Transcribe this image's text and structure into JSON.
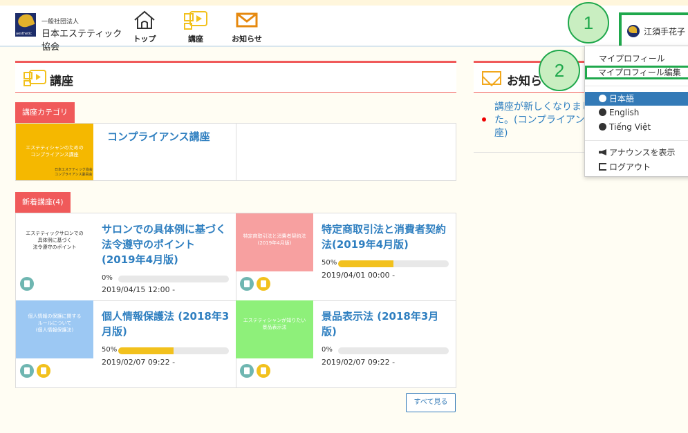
{
  "header": {
    "logo_small": "一般社団法人",
    "logo_big": "日本エステティック協会",
    "logo_mark_text": "aesthetic",
    "nav": [
      {
        "label": "トップ",
        "icon": "home-icon"
      },
      {
        "label": "講座",
        "icon": "course-icon"
      },
      {
        "label": "お知らせ",
        "icon": "mail-icon"
      }
    ],
    "user_name": "江須手花子"
  },
  "callouts": [
    "1",
    "2"
  ],
  "user_menu": {
    "items": [
      {
        "label": "マイプロフィール"
      },
      {
        "label": "マイプロフィール編集"
      },
      {
        "label": "日本語"
      },
      {
        "label": "English"
      },
      {
        "label": "Tiếng Việt"
      },
      {
        "label": "アナウンスを表示"
      },
      {
        "label": "ログアウト"
      }
    ]
  },
  "courses": {
    "title": "講座",
    "category_tag": "講座カテゴリ",
    "category": {
      "title": "コンプライアンス講座",
      "thumb_line1": "エステティシャンのための",
      "thumb_line2": "コンプライアンス講座",
      "thumb_org1": "日本エステティック協会",
      "thumb_org2": "コンプライアンス委員会"
    },
    "new_tag": "新着講座(4)",
    "items": [
      {
        "title": "サロンでの具体例に基づく法令遵守のポイント (2019年4月版)",
        "thumb_lines": [
          "エステティックサロンでの",
          "具体例に基づく",
          "法令遵守のポイント"
        ],
        "progress_label": "0%",
        "progress": 0,
        "date": "2019/04/15 12:00 -",
        "badges": [
          "camera-icon"
        ],
        "thumb_color": "#ffffff"
      },
      {
        "title": "特定商取引法と消費者契約法(2019年4月版)",
        "thumb_lines": [
          "特定商取引法と消費者契約法",
          "(2019年4月版)"
        ],
        "progress_label": "50%",
        "progress": 0.5,
        "date": "2019/04/01 00:00 -",
        "badges": [
          "camera-icon",
          "document-icon"
        ],
        "thumb_color": "#f7a0a0"
      },
      {
        "title": "個人情報保護法 (2018年3月版)",
        "thumb_lines": [
          "個人情報の保護に関する",
          "ルールについて",
          "(個人情報保護法)"
        ],
        "progress_label": "50%",
        "progress": 0.5,
        "date": "2019/02/07 09:22 -",
        "badges": [
          "camera-icon",
          "document-icon"
        ],
        "thumb_color": "#9cc8f3"
      },
      {
        "title": "景品表示法 (2018年3月版)",
        "thumb_lines": [
          "エステティシャンが知りたい",
          "景品表示法"
        ],
        "progress_label": "0%",
        "progress": 0,
        "date": "2019/02/07 09:22 -",
        "badges": [
          "camera-icon",
          "document-icon"
        ],
        "thumb_color": "#8ef07a"
      }
    ],
    "see_all": "すべて見る"
  },
  "news": {
    "title": "お知らせ",
    "item": "講座が新しくなりました。(コンプライアンス講座)"
  },
  "colors": {
    "accent_red": "#f05a5a",
    "link_blue": "#2f7fc0",
    "highlight_green": "#1fa84c",
    "progress_yellow": "#f2c11d"
  }
}
